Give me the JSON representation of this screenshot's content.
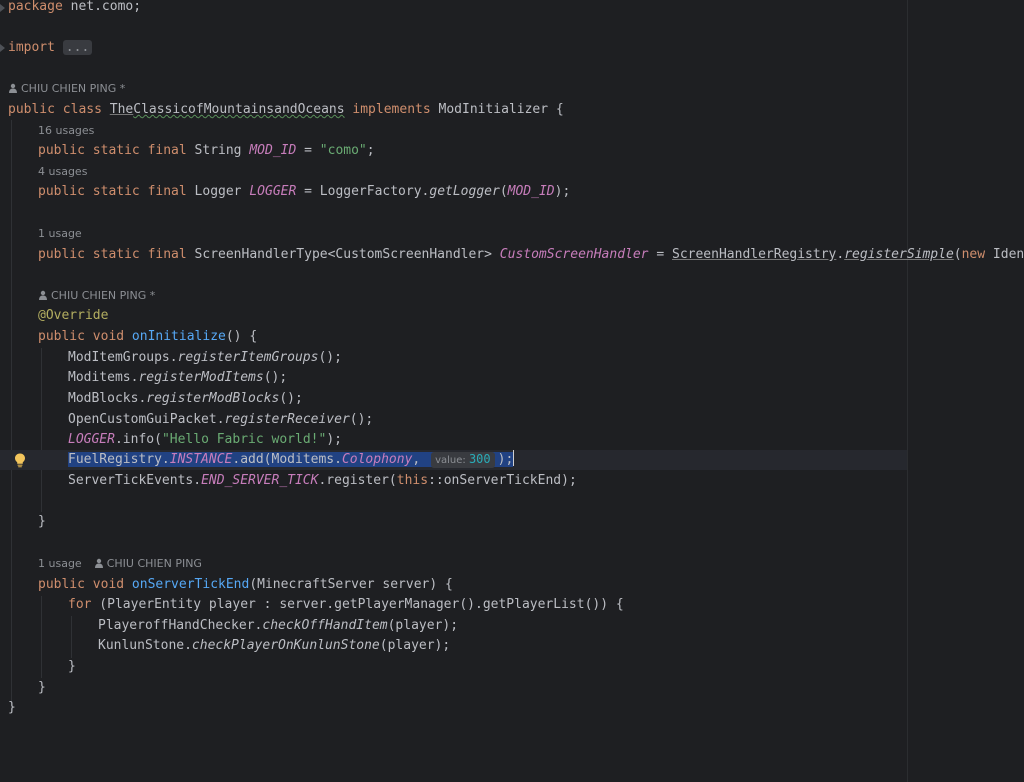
{
  "code": {
    "package_kw": "package",
    "package_name": " net.como;",
    "import_kw": "import",
    "import_folded": "...",
    "author_hint_1": "CHIU CHIEN PING *",
    "class_line": {
      "kw_public": "public",
      "kw_class": "class",
      "class_name_prefix": "The",
      "class_name_typo": "ClassicofMountainsandOceans",
      "kw_implements": "implements",
      "iface": "ModInitializer {"
    },
    "usage_hint_16": "16 usages",
    "mod_id_line": {
      "mods": "public static final",
      "type": " String ",
      "name": "MOD_ID",
      "eq": " = ",
      "value": "\"como\"",
      "end": ";"
    },
    "usage_hint_4": "4 usages",
    "logger_line": {
      "mods": "public static final",
      "type": " Logger ",
      "name": "LOGGER",
      "eq": " = LoggerFactory.",
      "method": "getLogger",
      "open": "(",
      "arg": "MOD_ID",
      "end": ");"
    },
    "usage_hint_1a": "1 usage",
    "screen_line": {
      "mods": "public static final",
      "type": " ScreenHandlerType<CustomScreenHandler> ",
      "name": "CustomScreenHandler",
      "eq": " = ",
      "registry": "ScreenHandlerRegistry",
      "dot": ".",
      "method": "registerSimple",
      "open": "(",
      "kw_new": "new",
      "rest": " Identifier"
    },
    "author_hint_2": "CHIU CHIEN PING *",
    "override": "@Override",
    "init_line": {
      "kw": "public void",
      "method": "onInitialize",
      "rest": "() {"
    },
    "body": {
      "l1_obj": "ModItemGroups.",
      "l1_method": "registerItemGroups",
      "l1_end": "();",
      "l2_obj": "Moditems.",
      "l2_method": "registerModItems",
      "l2_end": "();",
      "l3_obj": "ModBlocks.",
      "l3_method": "registerModBlocks",
      "l3_end": "();",
      "l4_obj": "OpenCustomGuiPacket.",
      "l4_method": "registerReceiver",
      "l4_end": "();",
      "l5_field": "LOGGER",
      "l5_call": ".info(",
      "l5_str": "\"Hello Fabric world!\"",
      "l5_end": ");",
      "l6_obj": "FuelRegistry.",
      "l6_field": "INSTANCE",
      "l6_call": ".add(Moditems.",
      "l6_arg": "Colophony",
      "l6_comma": ", ",
      "l6_hint_label": "value:",
      "l6_hint_value": "300",
      "l6_end": ");",
      "l7_obj": "ServerTickEvents.",
      "l7_field": "END_SERVER_TICK",
      "l7_call": ".register(",
      "l7_kw": "this",
      "l7_end": "::onServerTickEnd);"
    },
    "close_init": "}",
    "usage_hint_1b": "1 usage",
    "author_hint_3": "CHIU CHIEN PING",
    "tick_line": {
      "kw": "public void",
      "method": "onServerTickEnd",
      "rest": "(MinecraftServer server) {"
    },
    "for_line": {
      "kw": "for",
      "rest": " (PlayerEntity player : server.getPlayerManager().getPlayerList()) {"
    },
    "for_body": {
      "l1_obj": "PlayeroffHandChecker.",
      "l1_method": "checkOffHandItem",
      "l1_end": "(player);",
      "l2_obj": "KunlunStone.",
      "l2_method": "checkPlayerOnKunlunStone",
      "l2_end": "(player);"
    },
    "close_for": "}",
    "close_tick": "}",
    "close_class": "}"
  },
  "icons": {
    "person": "person-icon",
    "bulb": "lightbulb-icon",
    "fold": "fold-marker-icon"
  },
  "colors": {
    "background": "#1e1f22",
    "keyword": "#cf8e6d",
    "string": "#6aab73",
    "number": "#2aacb8",
    "field": "#c77dbb",
    "method": "#56a8f5",
    "annotation": "#b3ae60",
    "selection": "#214283"
  }
}
